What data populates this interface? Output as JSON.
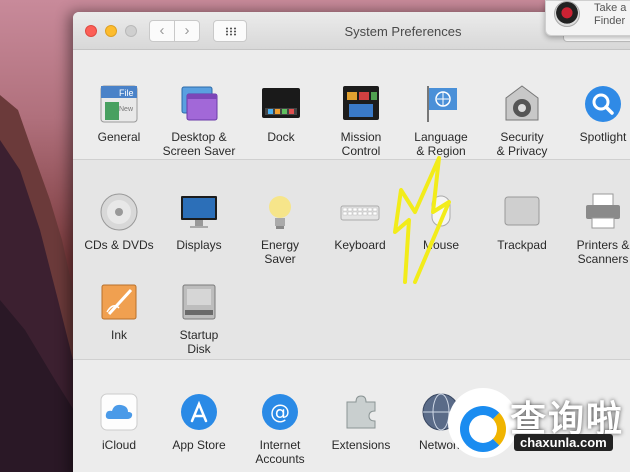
{
  "window": {
    "title": "System Preferences"
  },
  "notification": {
    "line1": "Take a",
    "line2": "Finder"
  },
  "sections": [
    {
      "panes": [
        {
          "label1": "General",
          "label2": "",
          "icon": "general-icon"
        },
        {
          "label1": "Desktop &",
          "label2": "Screen Saver",
          "icon": "desktop-screensaver-icon"
        },
        {
          "label1": "Dock",
          "label2": "",
          "icon": "dock-icon"
        },
        {
          "label1": "Mission",
          "label2": "Control",
          "icon": "mission-control-icon"
        },
        {
          "label1": "Language",
          "label2": "& Region",
          "icon": "language-region-icon"
        },
        {
          "label1": "Security",
          "label2": "& Privacy",
          "icon": "security-privacy-icon"
        },
        {
          "label1": "Spotlight",
          "label2": "",
          "icon": "spotlight-icon"
        }
      ]
    },
    {
      "panes": [
        {
          "label1": "CDs & DVDs",
          "label2": "",
          "icon": "cd-dvd-icon"
        },
        {
          "label1": "Displays",
          "label2": "",
          "icon": "displays-icon"
        },
        {
          "label1": "Energy",
          "label2": "Saver",
          "icon": "energy-saver-icon"
        },
        {
          "label1": "Keyboard",
          "label2": "",
          "icon": "keyboard-icon"
        },
        {
          "label1": "Mouse",
          "label2": "",
          "icon": "mouse-icon"
        },
        {
          "label1": "Trackpad",
          "label2": "",
          "icon": "trackpad-icon"
        },
        {
          "label1": "Printers &",
          "label2": "Scanners",
          "icon": "printer-icon"
        },
        {
          "label1": "Ink",
          "label2": "",
          "icon": "ink-icon"
        },
        {
          "label1": "Startup",
          "label2": "Disk",
          "icon": "startup-disk-icon"
        }
      ]
    },
    {
      "panes": [
        {
          "label1": "iCloud",
          "label2": "",
          "icon": "icloud-icon"
        },
        {
          "label1": "App Store",
          "label2": "",
          "icon": "app-store-icon"
        },
        {
          "label1": "Internet",
          "label2": "Accounts",
          "icon": "internet-accounts-icon"
        },
        {
          "label1": "Extensions",
          "label2": "",
          "icon": "extensions-icon"
        },
        {
          "label1": "Network",
          "label2": "",
          "icon": "network-icon"
        }
      ]
    }
  ],
  "watermark": {
    "chinese": "查询啦",
    "site": "chaxunla.com"
  },
  "colors": {
    "annotation_arrow": "#f2ec1a",
    "accent_blue": "#1a8cf0"
  }
}
